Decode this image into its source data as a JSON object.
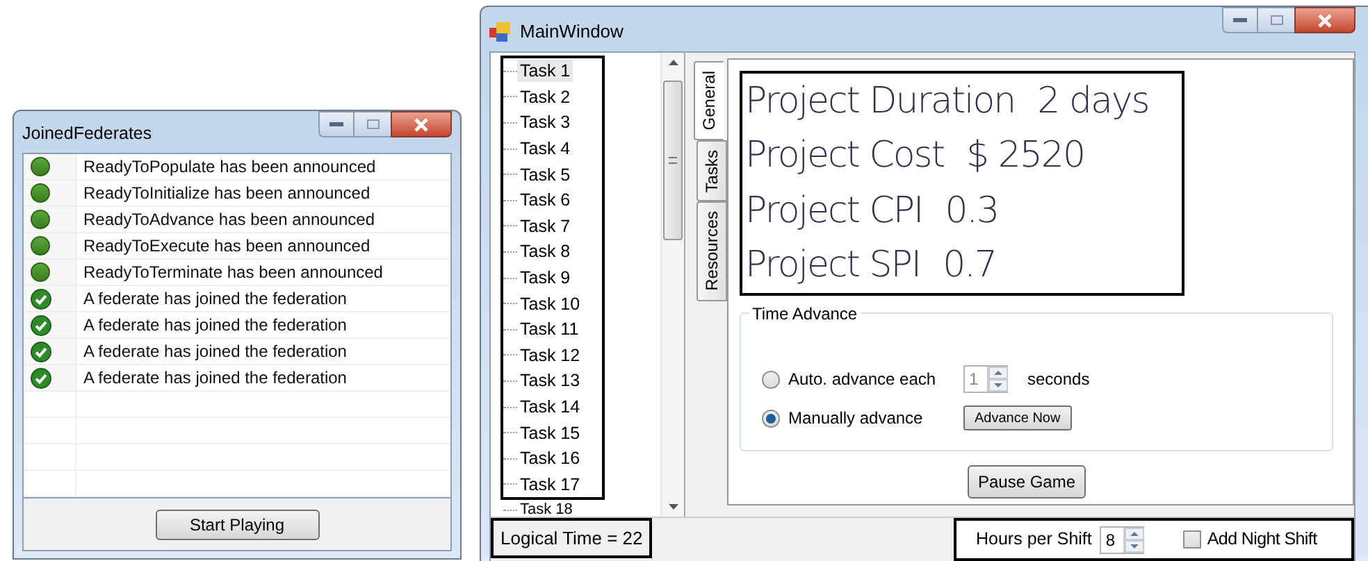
{
  "federates_window": {
    "title": "JoinedFederates",
    "rows": [
      {
        "kind": "announced",
        "message": "ReadyToPopulate has been announced"
      },
      {
        "kind": "announced",
        "message": "ReadyToInitialize has been announced"
      },
      {
        "kind": "announced",
        "message": "ReadyToAdvance has been announced"
      },
      {
        "kind": "announced",
        "message": "ReadyToExecute has been announced"
      },
      {
        "kind": "announced",
        "message": "ReadyToTerminate has been announced"
      },
      {
        "kind": "joined",
        "message": "A federate has joined the federation"
      },
      {
        "kind": "joined",
        "message": "A federate has joined the federation"
      },
      {
        "kind": "joined",
        "message": "A federate has joined the federation"
      },
      {
        "kind": "joined",
        "message": "A federate has joined the federation"
      }
    ],
    "button": "Start Playing"
  },
  "main_window": {
    "title": "MainWindow",
    "tasks": [
      {
        "label": "Task 1",
        "selected": true
      },
      {
        "label": "Task 2",
        "selected": false
      },
      {
        "label": "Task 3",
        "selected": false
      },
      {
        "label": "Task 4",
        "selected": false
      },
      {
        "label": "Task 5",
        "selected": false
      },
      {
        "label": "Task 6",
        "selected": false
      },
      {
        "label": "Task 7",
        "selected": false
      },
      {
        "label": "Task 8",
        "selected": false
      },
      {
        "label": "Task 9",
        "selected": false
      },
      {
        "label": "Task 10",
        "selected": false
      },
      {
        "label": "Task 11",
        "selected": false
      },
      {
        "label": "Task 12",
        "selected": false
      },
      {
        "label": "Task 13",
        "selected": false
      },
      {
        "label": "Task 14",
        "selected": false
      },
      {
        "label": "Task 15",
        "selected": false
      },
      {
        "label": "Task 16",
        "selected": false
      },
      {
        "label": "Task 17",
        "selected": false
      },
      {
        "label": "Task 18",
        "selected": false
      }
    ],
    "tabs": [
      {
        "label": "General",
        "selected": true
      },
      {
        "label": "Tasks",
        "selected": false
      },
      {
        "label": "Resources",
        "selected": false
      }
    ],
    "metrics": [
      {
        "label": "Project Duration",
        "value": "2 days"
      },
      {
        "label": "Project Cost",
        "value": "$ 2520"
      },
      {
        "label": "Project CPI",
        "value": "0.3"
      },
      {
        "label": "Project SPI",
        "value": "0.7"
      }
    ],
    "time_advance": {
      "title": "Time Advance",
      "auto": {
        "label": "Auto. advance each",
        "selected": false,
        "value": "1",
        "unit": "seconds"
      },
      "manual": {
        "label": "Manually advance",
        "selected": true,
        "button": "Advance Now"
      }
    },
    "pause_button": "Pause Game",
    "status_bar": {
      "logical_time": "Logical Time = 22",
      "hours_label": "Hours per Shift",
      "hours_value": "8",
      "night_shift": {
        "label": "Add Night Shift",
        "checked": false
      }
    }
  }
}
